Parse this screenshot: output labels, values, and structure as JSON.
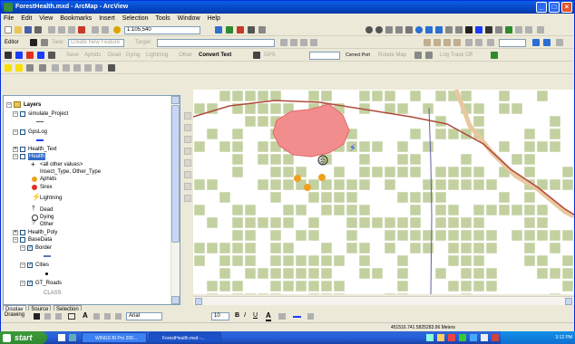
{
  "window": {
    "title": "ForestHealth.mxd - ArcMap - ArcView",
    "controls": [
      "_",
      "□",
      "×"
    ]
  },
  "menubar": {
    "items": [
      "File",
      "Edit",
      "View",
      "Bookmarks",
      "Insert",
      "Selection",
      "Tools",
      "Window",
      "Help"
    ]
  },
  "standard_toolbar": {
    "scale_value": "1:105,540"
  },
  "editor_toolbar": {
    "editor_label": "Editor",
    "task_label": "Task:",
    "task_value": "Create New Feature",
    "target_label": "Target:"
  },
  "tracking_toolbar": {
    "items": [
      "Save",
      "Aphids",
      "Dead",
      "Dying",
      "Lightning",
      "Other"
    ],
    "convert_text": "Convert Text",
    "gps_label": "GPS",
    "correct_port": "Correct Port",
    "rotate_map": "Rotate Map",
    "log_track": "Log Track Off"
  },
  "toc": {
    "root": "Layers",
    "layers": [
      {
        "name": "simulate_Project",
        "checked": false
      },
      {
        "name": "GpsLog",
        "checked": false
      },
      {
        "name": "Health_Text",
        "checked": false
      },
      {
        "name": "Health",
        "checked": false,
        "selected": true
      },
      {
        "name": "Health_Poly",
        "checked": false
      },
      {
        "name": "BaseData",
        "checked": false
      },
      {
        "name": "Border",
        "checked": true
      },
      {
        "name": "Cities",
        "checked": true
      },
      {
        "name": "GT_Roads",
        "checked": true
      }
    ],
    "health_legend": {
      "all_other": "<all other values>",
      "field": "Insect_Type, Other_Type",
      "classes": [
        "Aphids",
        "Sirex",
        "Lightning",
        "Dead",
        "Dying",
        "Other"
      ]
    },
    "class_label": "CLASS",
    "tabs": [
      "Display",
      "Source",
      "Selection"
    ]
  },
  "draw_toolbar": {
    "drawing_label": "Drawing",
    "font_name": "Arial",
    "font_size": "10",
    "bold": "B",
    "italic": "I",
    "underline": "U"
  },
  "status": {
    "coords": "451516.741  5825283.96 Meters"
  },
  "taskbar": {
    "start": "start",
    "tasks": [
      "WINGS BI Pro 200...",
      "ForestHealth.mxd -..."
    ],
    "clock": "3:12 PM"
  },
  "colors": {
    "title_blue": "#0a5fe8",
    "parcel_green": "#c3d1a1",
    "red_zone": "#f28d8d",
    "road_red": "#b04a3a",
    "aphids_orange": "#f0a020",
    "sirex_red": "#e03020",
    "lightning_blue": "#1a3cff"
  }
}
